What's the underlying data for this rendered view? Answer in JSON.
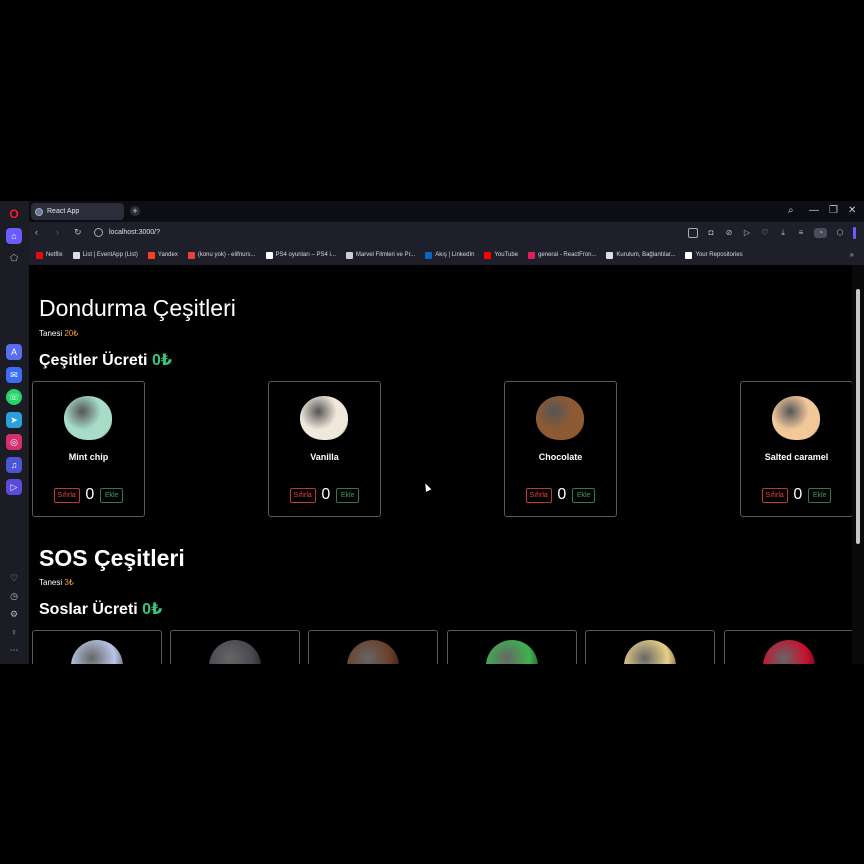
{
  "browser": {
    "tab_title": "React App",
    "url": "localhost:3000/?",
    "bookmarks": [
      {
        "label": "Netflix",
        "color": "#e50914"
      },
      {
        "label": "List | EventApp (List)",
        "color": "#dddddd"
      },
      {
        "label": "Yandex",
        "color": "#fc3f1d"
      },
      {
        "label": "(konu yok) - elifnurs...",
        "color": "#ea4335"
      },
      {
        "label": "PS4 oyunları – PS4 i...",
        "color": "#ffffff"
      },
      {
        "label": "Marvel Filmleri ve Pr...",
        "color": "#cccccc"
      },
      {
        "label": "Akış | LinkedIn",
        "color": "#0a66c2"
      },
      {
        "label": "YouTube",
        "color": "#ff0000"
      },
      {
        "label": "general - ReactFron...",
        "color": "#e01e5a"
      },
      {
        "label": "Kurulum, Bağlantılar...",
        "color": "#dddddd"
      },
      {
        "label": "Your Repositories",
        "color": "#ffffff"
      }
    ]
  },
  "page": {
    "ice_cream": {
      "title": "Dondurma Çeşitleri",
      "unit_label": "Tanesi",
      "unit_price": "20₺",
      "total_label": "Çeşitler Ücreti",
      "total_value": "0₺",
      "items": [
        {
          "name": "Mint chip",
          "count": "0",
          "color": "#a6dcc8"
        },
        {
          "name": "Vanilla",
          "count": "0",
          "color": "#f1e8dc"
        },
        {
          "name": "Chocolate",
          "count": "0",
          "color": "#8e5a33"
        },
        {
          "name": "Salted caramel",
          "count": "0",
          "color": "#f2c79a"
        }
      ],
      "reset_label": "Sıfırla",
      "add_label": "Ekle"
    },
    "sauces": {
      "title": "SOS Çeşitleri",
      "unit_label": "Tanesi",
      "unit_price": "3₺",
      "total_label": "Soslar Ücreti",
      "total_value": "0₺",
      "items": [
        {
          "color": "#b9c6e6"
        },
        {
          "color": "#4a4850"
        },
        {
          "color": "#6b3e2a"
        },
        {
          "color": "#3fb24f"
        },
        {
          "color": "#e9cf86"
        },
        {
          "color": "#c8102e"
        }
      ]
    }
  }
}
